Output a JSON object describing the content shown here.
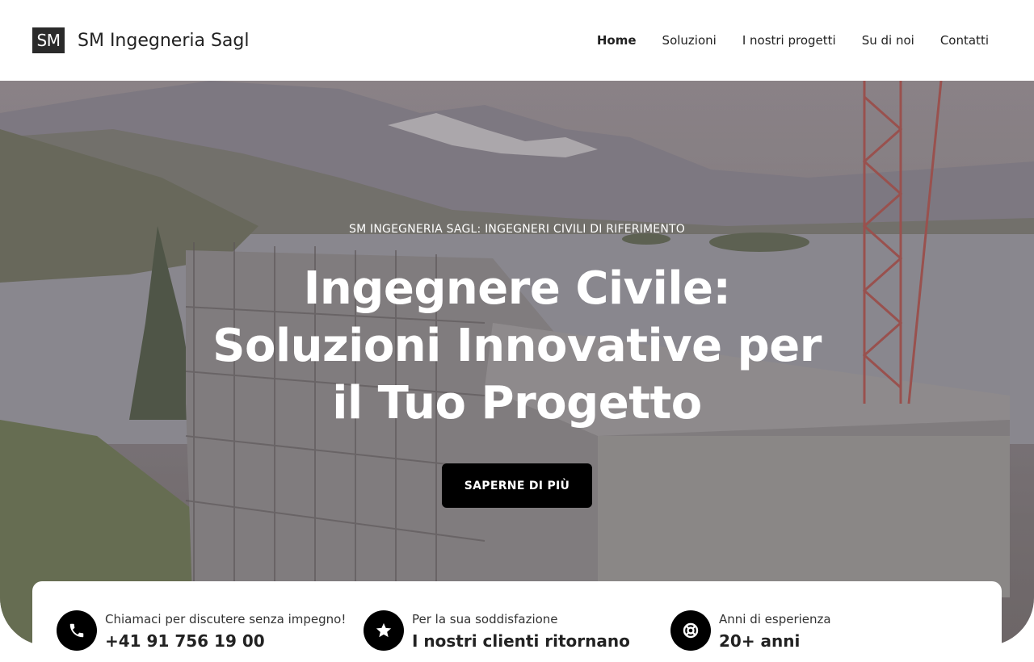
{
  "header": {
    "logo_text": "SM",
    "brand_name": "SM Ingegneria Sagl",
    "nav": [
      {
        "label": "Home",
        "active": true
      },
      {
        "label": "Soluzioni"
      },
      {
        "label": "I nostri progetti"
      },
      {
        "label": "Su di noi"
      },
      {
        "label": "Contatti"
      }
    ]
  },
  "hero": {
    "eyebrow": "SM INGEGNERIA SAGL: INGEGNERI CIVILI DI RIFERIMENTO",
    "headline": "Ingegnere Civile: Soluzioni Innovative per il Tuo Progetto",
    "cta_label": "SAPERNE DI PIÙ"
  },
  "info_bar": [
    {
      "icon": "phone-icon",
      "label": "Chiamaci per discutere senza impegno!",
      "value": "+41 91 756 19 00"
    },
    {
      "icon": "star-icon",
      "label": "Per la sua soddisfazione",
      "value": "I nostri clienti ritornano"
    },
    {
      "icon": "lifebuoy-icon",
      "label": "Anni di esperienza",
      "value": "20+ anni"
    }
  ],
  "colors": {
    "accent": "#000000",
    "background": "#ffffff",
    "text": "#222222"
  }
}
